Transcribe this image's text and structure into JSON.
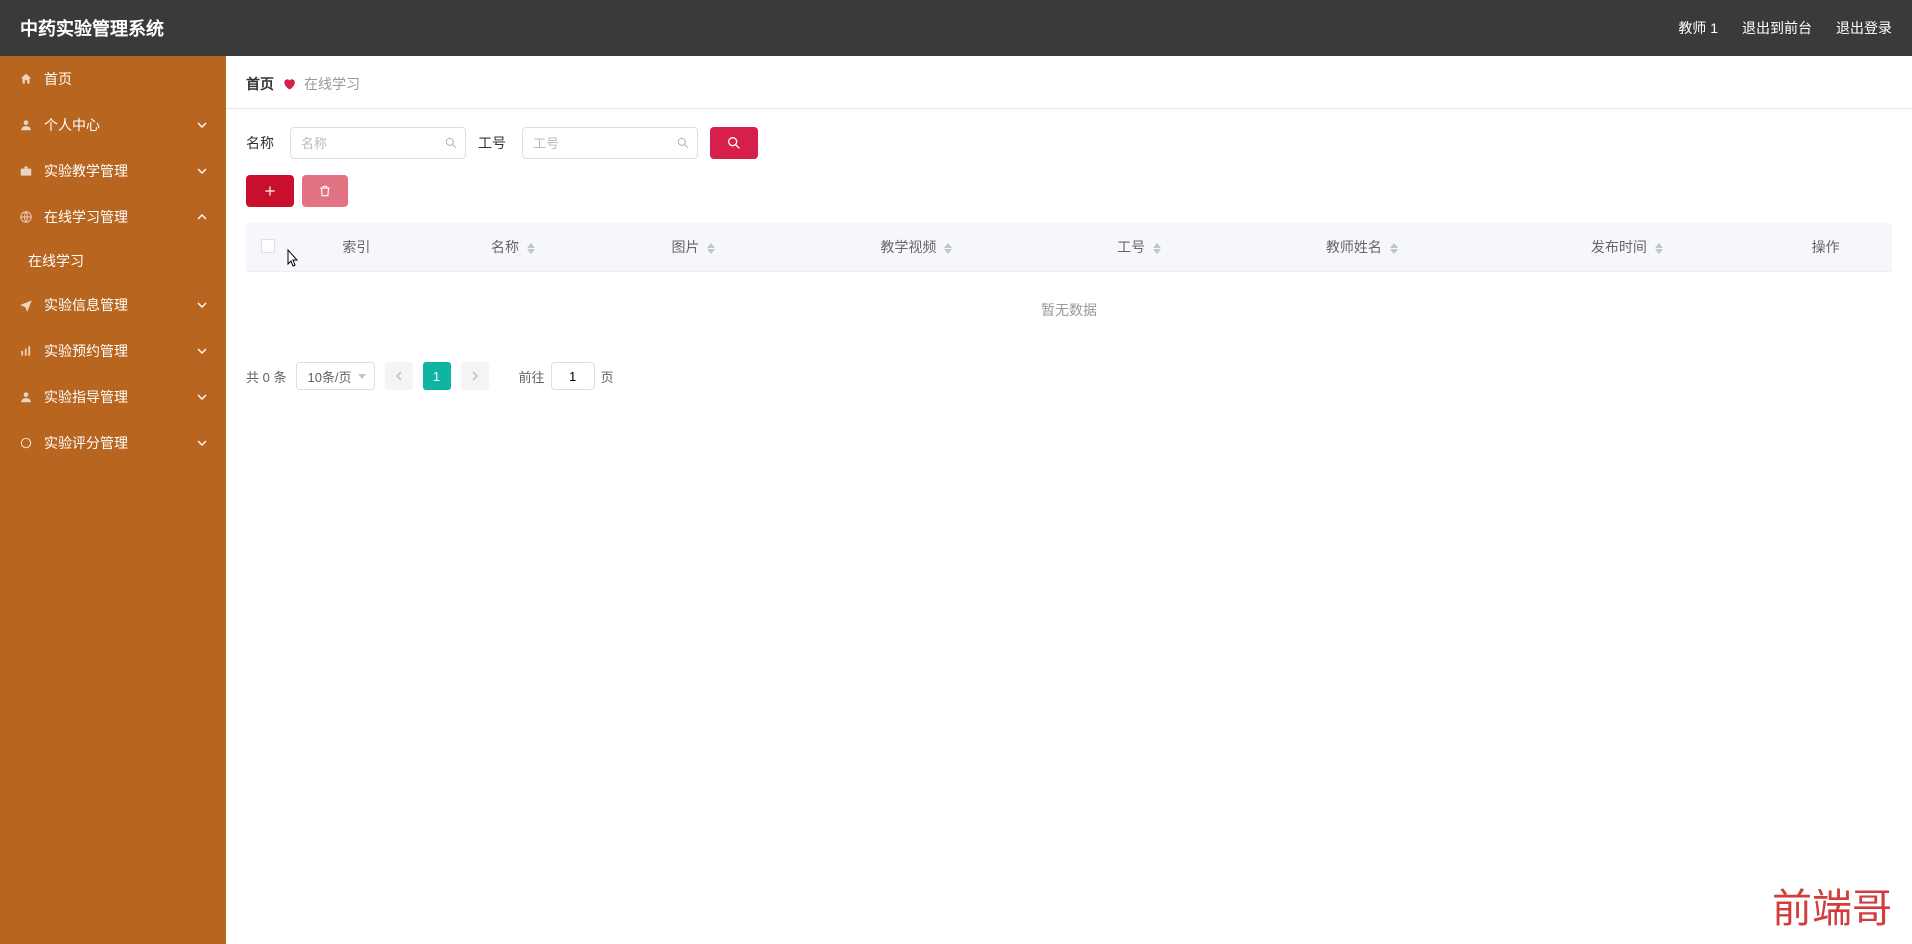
{
  "header": {
    "title": "中药实验管理系统",
    "user": "教师 1",
    "back_front": "退出到前台",
    "logout": "退出登录"
  },
  "sidebar": {
    "items": [
      {
        "label": "首页",
        "icon": "home",
        "expandable": false
      },
      {
        "label": "个人中心",
        "icon": "user",
        "expandable": true,
        "expanded": false
      },
      {
        "label": "实验教学管理",
        "icon": "briefcase",
        "expandable": true,
        "expanded": false
      },
      {
        "label": "在线学习管理",
        "icon": "globe",
        "expandable": true,
        "expanded": true,
        "children": [
          {
            "label": "在线学习"
          }
        ]
      },
      {
        "label": "实验信息管理",
        "icon": "plane",
        "expandable": true,
        "expanded": false
      },
      {
        "label": "实验预约管理",
        "icon": "bars",
        "expandable": true,
        "expanded": false
      },
      {
        "label": "实验指导管理",
        "icon": "user",
        "expandable": true,
        "expanded": false
      },
      {
        "label": "实验评分管理",
        "icon": "circle",
        "expandable": true,
        "expanded": false
      }
    ]
  },
  "breadcrumb": {
    "home": "首页",
    "current": "在线学习"
  },
  "filters": {
    "name_label": "名称",
    "name_placeholder": "名称",
    "job_label": "工号",
    "job_placeholder": "工号"
  },
  "table": {
    "columns": [
      "索引",
      "名称",
      "图片",
      "教学视频",
      "工号",
      "教师姓名",
      "发布时间",
      "操作"
    ],
    "sortable": [
      false,
      true,
      true,
      true,
      true,
      true,
      true,
      false
    ],
    "empty_text": "暂无数据"
  },
  "pagination": {
    "total_text": "共 0 条",
    "page_size": "10条/页",
    "current": "1",
    "jump_prefix": "前往",
    "jump_value": "1",
    "jump_suffix": "页"
  },
  "watermark": "前端哥"
}
